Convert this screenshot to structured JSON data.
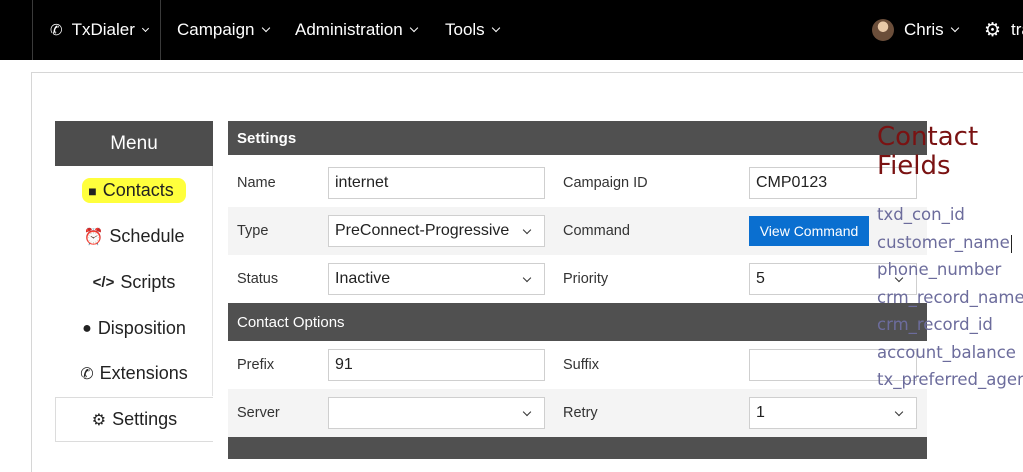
{
  "nav": {
    "brand": "TxDialer",
    "campaign": "Campaign",
    "administration": "Administration",
    "tools": "Tools",
    "user": "Chris",
    "extra": "tra"
  },
  "menu": {
    "title": "Menu",
    "items": [
      {
        "label": "Contacts",
        "icon": "user-icon"
      },
      {
        "label": "Schedule",
        "icon": "alarm-clock-icon"
      },
      {
        "label": "Scripts",
        "icon": "code-icon"
      },
      {
        "label": "Disposition",
        "icon": "comment-icon"
      },
      {
        "label": "Extensions",
        "icon": "phone-icon"
      },
      {
        "label": "Settings",
        "icon": "gear-icon"
      }
    ]
  },
  "settings": {
    "header": "Settings",
    "name_label": "Name",
    "name_value": "internet",
    "campaign_id_label": "Campaign ID",
    "campaign_id_value": "CMP0123",
    "type_label": "Type",
    "type_value": "PreConnect-Progressive",
    "command_label": "Command",
    "view_command_button": "View Command",
    "status_label": "Status",
    "status_value": "Inactive",
    "priority_label": "Priority",
    "priority_value": "5"
  },
  "contact_options": {
    "header": "Contact Options",
    "prefix_label": "Prefix",
    "prefix_value": "91",
    "suffix_label": "Suffix",
    "suffix_value": "",
    "server_label": "Server",
    "server_value": "",
    "retry_label": "Retry",
    "retry_value": "1"
  },
  "contact_fields": {
    "title": "Contact Fields",
    "fields": [
      "txd_con_id",
      "customer_name",
      "phone_number",
      "crm_record_name",
      "crm_record_id",
      "account_balance",
      "tx_preferred_agent"
    ]
  },
  "colors": {
    "nav_bg": "#000000",
    "section_header": "#505050",
    "highlight": "#ffff3c",
    "button": "#0a6fd0",
    "contact_title": "#7a1212",
    "contact_field": "#6c6c9c"
  }
}
